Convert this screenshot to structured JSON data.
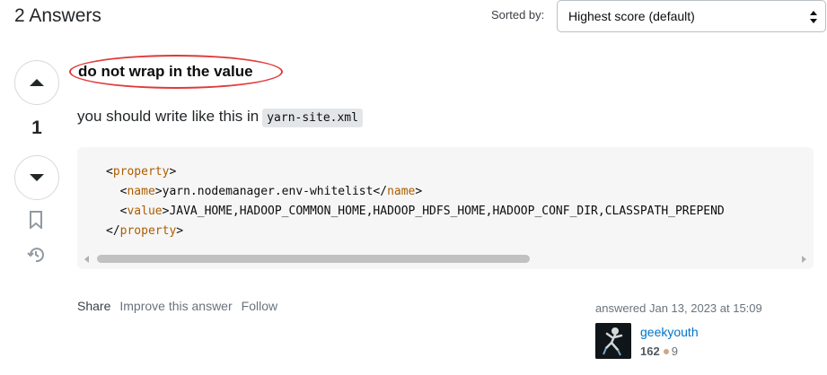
{
  "header": {
    "answers_count": "2 Answers",
    "sort_label": "Sorted by:",
    "sort_value": "Highest score (default)"
  },
  "vote": {
    "count": "1"
  },
  "answer": {
    "title": "do not wrap in the value",
    "text": "you should write like this in",
    "inline_code": "yarn-site.xml",
    "code": {
      "line1_open": "<",
      "line1_tag": "property",
      "line1_close": ">",
      "line2_open": "<",
      "line2_tag": "name",
      "line2_mid": ">yarn.nodemanager.env-whitelist</",
      "line2_tag2": "name",
      "line2_close": ">",
      "line3_open": "<",
      "line3_tag": "value",
      "line3_rest": ">JAVA_HOME,HADOOP_COMMON_HOME,HADOOP_HDFS_HOME,HADOOP_CONF_DIR,CLASSPATH_PREPEND",
      "line4_open": "</",
      "line4_tag": "property",
      "line4_close": ">"
    }
  },
  "post_menu": {
    "share": "Share",
    "improve": "Improve this answer",
    "follow": "Follow"
  },
  "user": {
    "action": "answered Jan 13, 2023 at 15:09",
    "name": "geekyouth",
    "reputation": "162",
    "bronze_badges": "9"
  },
  "colors": {
    "accent_link": "#0074cc",
    "annotation_oval": "#e03a3a",
    "xml_tag": "#ab5d00"
  },
  "icons": [
    "chevron-up-icon",
    "chevron-down-icon",
    "bookmark-icon",
    "history-icon",
    "select-arrows-icon"
  ]
}
